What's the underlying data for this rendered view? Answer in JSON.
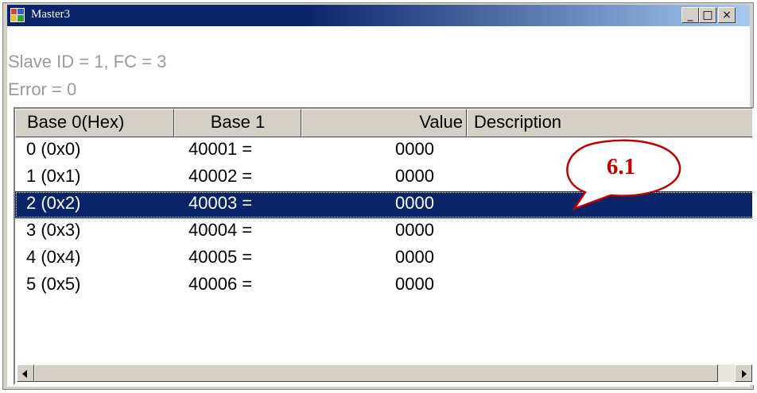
{
  "window": {
    "title": "Master3",
    "icon": "app-window-icon",
    "caption_buttons": [
      {
        "name": "minimize-icon",
        "glyph": "_"
      },
      {
        "name": "maximize-icon",
        "glyph": "□"
      },
      {
        "name": "close-icon",
        "glyph": "×"
      }
    ]
  },
  "status": {
    "line1": "Slave ID = 1, FC = 3",
    "line2": "Error = 0"
  },
  "table": {
    "columns": [
      "Base 0(Hex)",
      "Base 1",
      "Value",
      "Description"
    ],
    "rows": [
      {
        "base0": "0 (0x0)",
        "base1": "40001  =",
        "value": "0000",
        "description": ""
      },
      {
        "base0": "1 (0x1)",
        "base1": "40002  =",
        "value": "0000",
        "description": ""
      },
      {
        "base0": "2 (0x2)",
        "base1": "40003  =",
        "value": "0000",
        "description": ""
      },
      {
        "base0": "3 (0x3)",
        "base1": "40004  =",
        "value": "0000",
        "description": ""
      },
      {
        "base0": "4 (0x4)",
        "base1": "40005  =",
        "value": "0000",
        "description": ""
      },
      {
        "base0": "5 (0x5)",
        "base1": "40006  =",
        "value": "0000",
        "description": ""
      }
    ],
    "selected_row": 2
  },
  "callout": {
    "label": "6.1"
  },
  "colors": {
    "title_start": "#0a246a",
    "title_end": "#a6caf0",
    "selection": "#0a246a",
    "callout_text": "#c00000"
  }
}
